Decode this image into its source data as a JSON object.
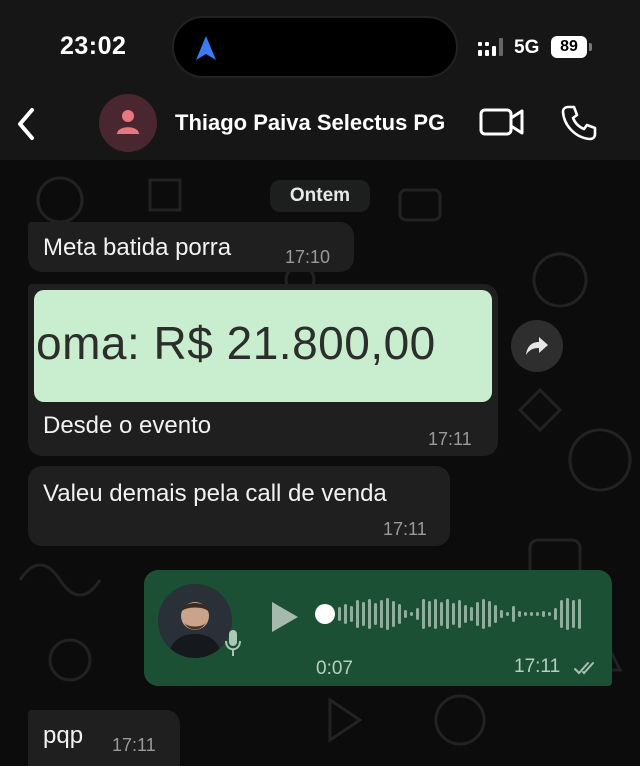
{
  "status_bar": {
    "time": "23:02",
    "network": "5G",
    "battery": "89"
  },
  "header": {
    "contact_name": "Thiago Paiva Selectus PG"
  },
  "chat": {
    "date_separator": "Ontem",
    "messages": [
      {
        "text": "Meta batida porra",
        "time": "17:10"
      },
      {
        "image_text": "oma: R$ 21.800,00",
        "text": "Desde o evento",
        "time": "17:11"
      },
      {
        "text": "Valeu demais pela call de venda",
        "time": "17:11"
      },
      {
        "type": "voice",
        "duration": "0:07",
        "time": "17:11",
        "status": "read"
      },
      {
        "text": "pqp",
        "time": "17:11"
      }
    ]
  },
  "colors": {
    "incoming_bubble": "#1f1f1f",
    "outgoing_bubble": "#1c5034",
    "image_background": "#c9edcf",
    "contact_avatar_icon": "#e8787d"
  },
  "icons": [
    "navigation-arrow-icon",
    "back-chevron-icon",
    "person-icon",
    "video-call-icon",
    "phone-icon",
    "share-arrow-icon",
    "microphone-icon",
    "play-icon",
    "double-check-icon"
  ]
}
